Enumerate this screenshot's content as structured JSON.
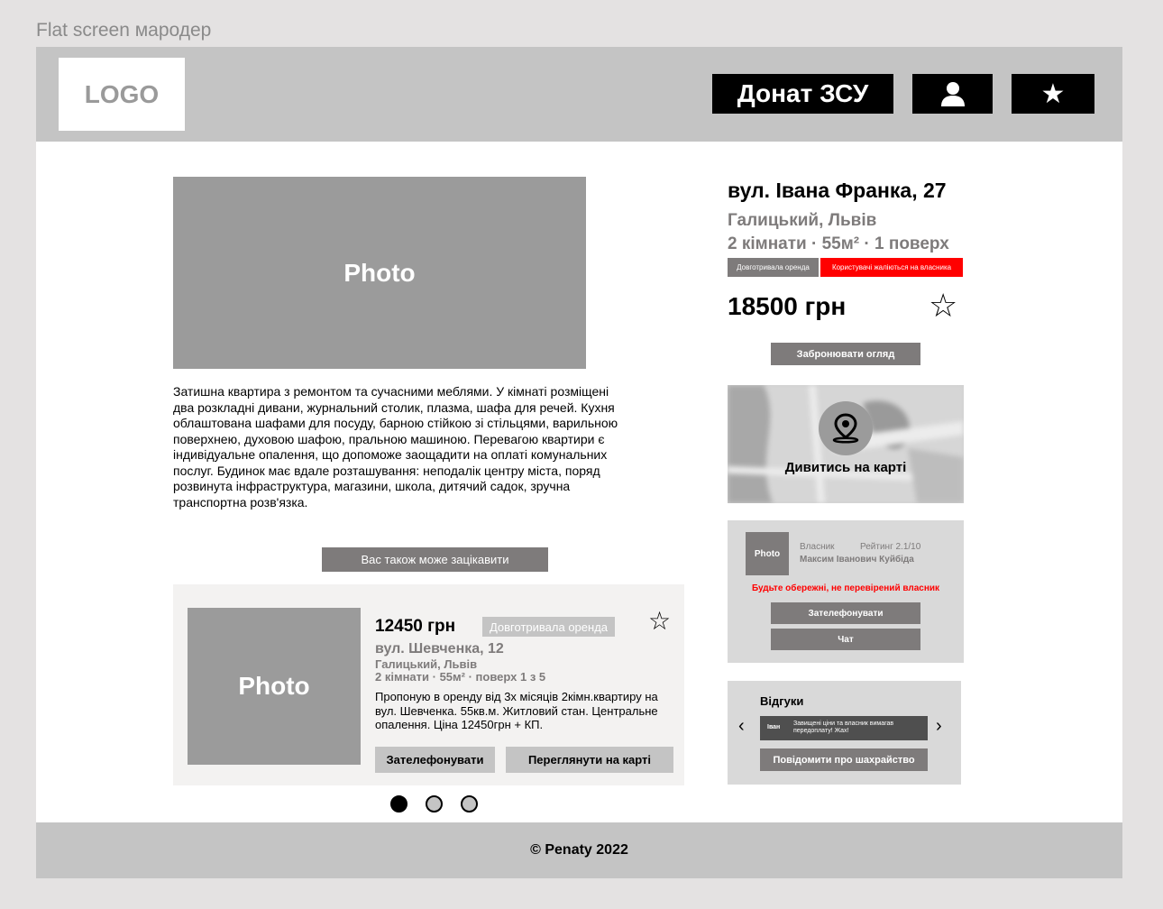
{
  "frame_title": "Flat screen мародер",
  "header": {
    "logo": "LOGO",
    "donate_label": "Донат ЗСУ",
    "user_icon": "user-icon",
    "star_icon": "star-icon"
  },
  "listing": {
    "photo_label": "Photo",
    "description": "Затишна квартира з ремонтом та сучасними меблями. У кімнаті розміщені два розкладні дивани, журнальний столик, плазма, шафа для речей. Кухня облаштована шафами для посуду, барною стійкою зі стільцями, варильною поверхнею, духовою шафою, пральною машиною. Перевагою квартири є індивідуальне опалення, що допоможе заощадити на оплаті комунальних послуг. Будинок має вдале розташування: неподалік центру міста, поряд розвинута інфраструктура, магазини, школа, дитячий садок, зручна транспортна розв'язка.",
    "street": "вул. Івана Франка, 27",
    "city": "Галицький, Львів",
    "params": "2 кімнати · 55м²  · 1 поверх",
    "tag_rent": "Довготривала оренда",
    "tag_warning": "Користувачі жаліються на власника",
    "price": "18500 грн",
    "book_label": "Забронювати огляд",
    "map_label": "Дивитись на карті"
  },
  "owner": {
    "photo_label": "Photo",
    "role": "Власник",
    "rating": "Рейтинг 2.1/10",
    "name": "Максим Іванович Куйбіда",
    "warning": "Будьте обережні, не перевірений власник",
    "call_label": "Зателефонувати",
    "chat_label": "Чат"
  },
  "reviews": {
    "title": "Відгуки",
    "items": [
      {
        "author": "Іван",
        "text": "Завищені ціни та власник вимагав передоплату! Жах!"
      }
    ],
    "report_label": "Повідомити про шахрайство"
  },
  "related": {
    "title": "Вас також може зацікавити",
    "card": {
      "photo_label": "Photo",
      "price": "12450 грн",
      "badge": "Довготривала оренда",
      "street": "вул. Шевченка, 12",
      "city": "Галицький, Львів",
      "params": "2 кімнати · 55м²  · поверх 1 з 5",
      "description": "Пропоную в оренду від 3х місяців 2кімн.квартиру на вул. Шевченка. 55кв.м. Житловий стан. Центральне опалення. Ціна 12450грн + КП.",
      "call_label": "Зателефонувати",
      "map_label": "Переглянути на карті"
    },
    "pagination": {
      "total": 3,
      "active": 1
    }
  },
  "footer": {
    "copyright": "© Penaty 2022"
  },
  "colors": {
    "header_bg": "#c4c4c4",
    "accent_dark": "#7e7b7b",
    "warning": "#ff0000",
    "photo_bg": "#9b9b9b"
  }
}
